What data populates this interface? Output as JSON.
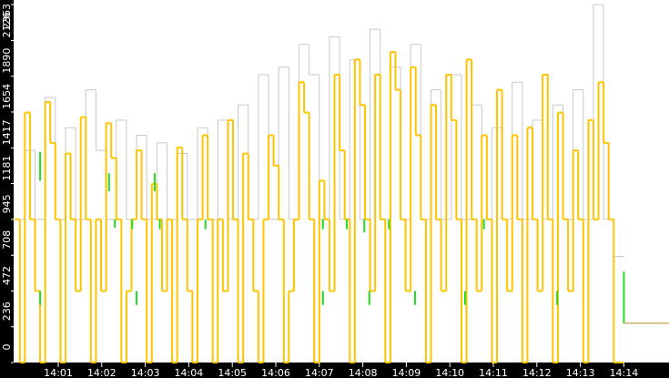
{
  "chart_data": {
    "type": "line",
    "title": "",
    "xlabel": "",
    "ylabel": "",
    "x_unit": "seconds after 14:00:00",
    "xlim": [
      0,
      902
    ],
    "ylim": [
      0,
      2363
    ],
    "grid": false,
    "y_ticks": [
      0,
      236,
      472,
      708,
      945,
      1181,
      1417,
      1654,
      1890,
      2126,
      2363
    ],
    "x_ticks": [
      {
        "t": 60,
        "label": "14:01"
      },
      {
        "t": 120,
        "label": "14:02"
      },
      {
        "t": 180,
        "label": "14:03"
      },
      {
        "t": 240,
        "label": "14:04"
      },
      {
        "t": 300,
        "label": "14:05"
      },
      {
        "t": 360,
        "label": "14:06"
      },
      {
        "t": 420,
        "label": "14:07"
      },
      {
        "t": 480,
        "label": "14:08"
      },
      {
        "t": 540,
        "label": "14:09"
      },
      {
        "t": 600,
        "label": "14:10"
      },
      {
        "t": 660,
        "label": "14:11"
      },
      {
        "t": 720,
        "label": "14:12"
      },
      {
        "t": 780,
        "label": "14:13"
      },
      {
        "t": 840,
        "label": "14:14"
      }
    ],
    "series": [
      {
        "name": "gray",
        "color": "#c8c8c8",
        "start": 0,
        "step": 14,
        "values": [
          945,
          1400,
          945,
          1750,
          945,
          1550,
          945,
          1800,
          1400,
          945,
          1600,
          945,
          1500,
          945,
          1450,
          945,
          1380,
          945,
          1550,
          945,
          1600,
          945,
          1700,
          945,
          1900,
          945,
          1950,
          945,
          2100,
          1900,
          945,
          2150,
          945,
          2000,
          945,
          2200,
          945,
          1950,
          945,
          2100,
          945,
          1800,
          945,
          1900,
          945,
          1700,
          945,
          1550,
          945,
          1850,
          945,
          1600,
          945,
          1700,
          945,
          1800,
          945,
          2363,
          945,
          700
        ]
      },
      {
        "name": "orange",
        "color": "#ffc400",
        "start": 0,
        "step": 7,
        "values": [
          945,
          0,
          1650,
          945,
          472,
          0,
          1720,
          1450,
          945,
          0,
          1380,
          945,
          472,
          1620,
          945,
          0,
          945,
          472,
          1580,
          1350,
          945,
          0,
          472,
          945,
          1400,
          945,
          0,
          1180,
          945,
          472,
          945,
          0,
          1420,
          945,
          472,
          0,
          945,
          1500,
          945,
          0,
          945,
          472,
          1600,
          945,
          0,
          1380,
          945,
          472,
          0,
          945,
          1500,
          1300,
          945,
          0,
          472,
          945,
          1850,
          1650,
          945,
          0,
          1200,
          945,
          472,
          1900,
          1400,
          945,
          0,
          2000,
          1700,
          945,
          472,
          1900,
          945,
          0,
          2050,
          1800,
          945,
          472,
          1950,
          1500,
          945,
          0,
          1700,
          945,
          472,
          1900,
          1600,
          945,
          0,
          2000,
          945,
          472,
          1500,
          945,
          0,
          1800,
          945,
          472,
          1500,
          945,
          0,
          1550,
          945,
          472,
          1900,
          945,
          0,
          1650,
          945,
          472,
          1400,
          945,
          0,
          1600,
          945,
          1850,
          1450,
          945,
          0,
          0
        ]
      },
      {
        "name": "green",
        "color": "#22dd22",
        "segments": [
          [
            35,
            1390,
            1200
          ],
          [
            35,
            472,
            380
          ],
          [
            130,
            1250,
            1130
          ],
          [
            138,
            945,
            890
          ],
          [
            162,
            945,
            880
          ],
          [
            168,
            472,
            380
          ],
          [
            193,
            1250,
            1130
          ],
          [
            200,
            945,
            880
          ],
          [
            263,
            945,
            880
          ],
          [
            425,
            472,
            380
          ],
          [
            425,
            945,
            880
          ],
          [
            458,
            945,
            880
          ],
          [
            482,
            945,
            860
          ],
          [
            489,
            472,
            380
          ],
          [
            516,
            945,
            880
          ],
          [
            552,
            472,
            380
          ],
          [
            621,
            472,
            380
          ],
          [
            647,
            945,
            880
          ],
          [
            748,
            472,
            380
          ],
          [
            840,
            600,
            259
          ]
        ],
        "tail": {
          "from": 840,
          "to": 902,
          "value": 259
        }
      }
    ]
  }
}
